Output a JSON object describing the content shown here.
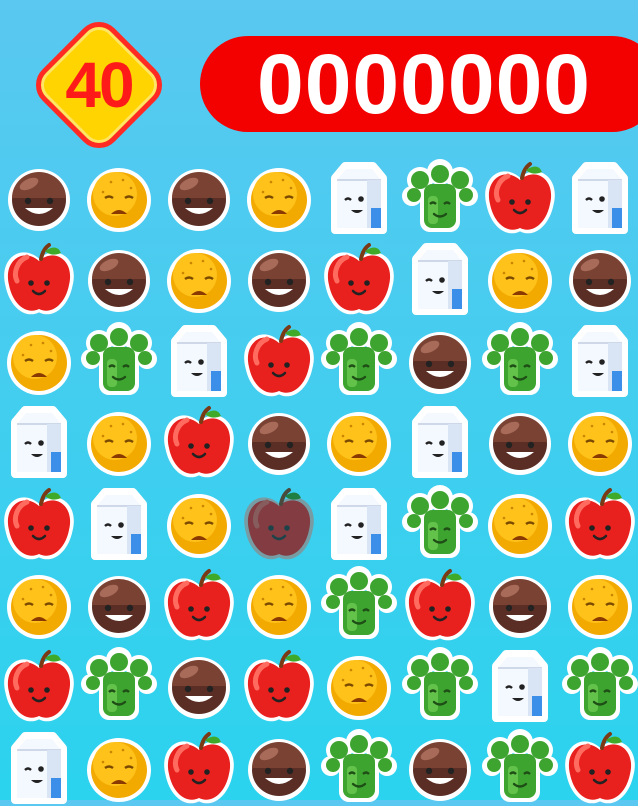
{
  "hud": {
    "moves": "40",
    "score": "0000000",
    "colors": {
      "badge_fill": "#ffd400",
      "badge_border": "#ff2a24",
      "score_bar": "#f30000"
    }
  },
  "board": {
    "rows": 8,
    "cols": 8,
    "selected": {
      "row": 4,
      "col": 3
    },
    "grid": [
      [
        "coconut",
        "orange",
        "coconut",
        "orange",
        "milk",
        "broccoli",
        "apple",
        "milk"
      ],
      [
        "apple",
        "coconut",
        "orange",
        "coconut",
        "apple",
        "milk",
        "orange",
        "coconut"
      ],
      [
        "orange",
        "broccoli",
        "milk",
        "apple",
        "broccoli",
        "coconut",
        "broccoli",
        "milk"
      ],
      [
        "milk",
        "orange",
        "apple",
        "coconut",
        "orange",
        "milk",
        "coconut",
        "orange"
      ],
      [
        "apple",
        "milk",
        "orange",
        "apple",
        "milk",
        "broccoli",
        "orange",
        "apple"
      ],
      [
        "orange",
        "coconut",
        "apple",
        "orange",
        "broccoli",
        "apple",
        "coconut",
        "orange"
      ],
      [
        "apple",
        "broccoli",
        "coconut",
        "apple",
        "orange",
        "broccoli",
        "milk",
        "broccoli"
      ],
      [
        "milk",
        "orange",
        "apple",
        "coconut",
        "broccoli",
        "coconut",
        "broccoli",
        "apple"
      ]
    ],
    "piece_icons": {
      "coconut": "coconut-icon",
      "orange": "orange-icon",
      "milk": "milk-carton-icon",
      "broccoli": "broccoli-icon",
      "apple": "apple-icon"
    }
  }
}
